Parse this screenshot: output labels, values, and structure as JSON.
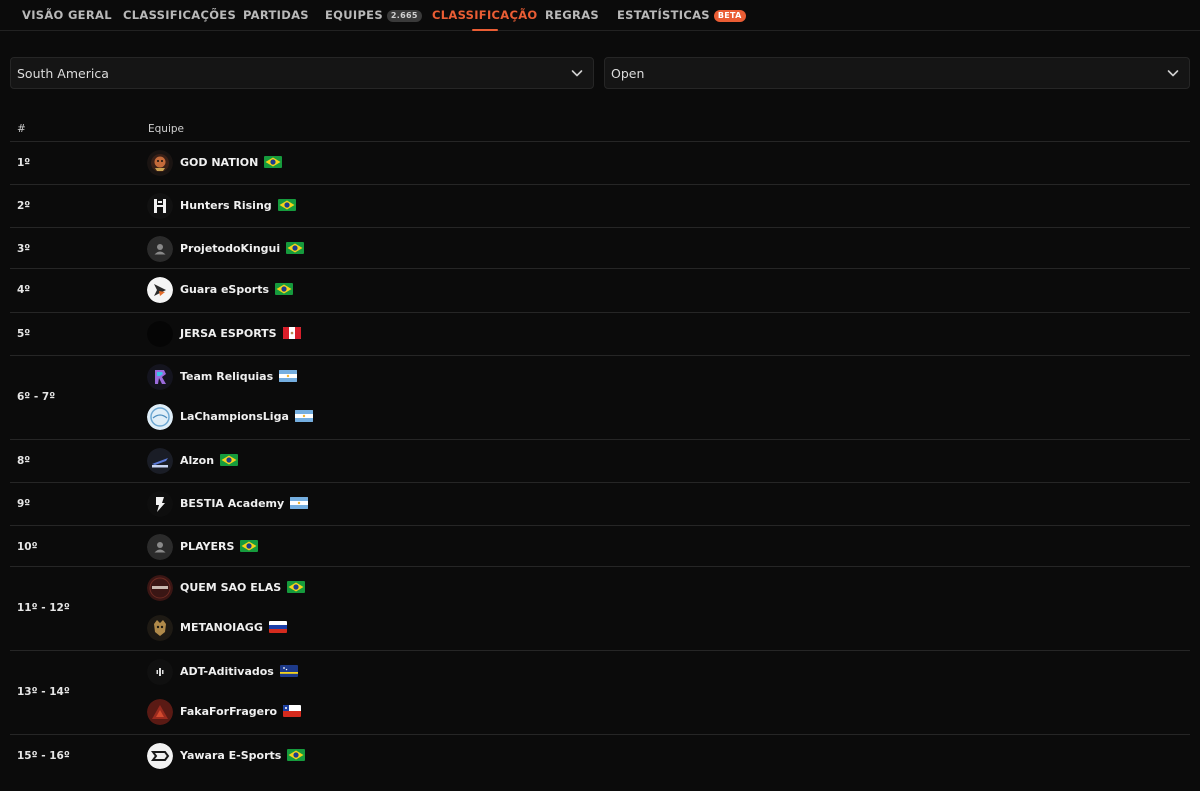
{
  "tabs": [
    {
      "label": "VISÃO GERAL"
    },
    {
      "label": "CLASSIFICAÇÕES"
    },
    {
      "label": "PARTIDAS"
    },
    {
      "label": "EQUIPES",
      "badge": "2.665"
    },
    {
      "label": "CLASSIFICAÇÃO",
      "active": true
    },
    {
      "label": "REGRAS"
    },
    {
      "label": "ESTATÍSTICAS",
      "badge": "BETA"
    }
  ],
  "filters": {
    "region": "South America",
    "division": "Open"
  },
  "table": {
    "col_rank": "#",
    "col_team": "Equipe",
    "groups": [
      {
        "rank": "1º",
        "teams": [
          {
            "name": "GOD NATION",
            "flag": "BR",
            "avatar": "godnation-logo"
          }
        ]
      },
      {
        "rank": "2º",
        "teams": [
          {
            "name": "Hunters Rising",
            "flag": "BR",
            "avatar": "hunters-logo"
          }
        ]
      },
      {
        "rank": "3º",
        "teams": [
          {
            "name": "ProjetodoKingui",
            "flag": "BR",
            "avatar": "default-avatar"
          }
        ]
      },
      {
        "rank": "4º",
        "teams": [
          {
            "name": "Guara eSports",
            "flag": "BR",
            "avatar": "guara-logo"
          }
        ]
      },
      {
        "rank": "5º",
        "teams": [
          {
            "name": "JERSA ESPORTS",
            "flag": "PE",
            "avatar": "jersa-logo"
          }
        ]
      },
      {
        "rank": "6º - 7º",
        "teams": [
          {
            "name": "Team Reliquias",
            "flag": "AR",
            "avatar": "reliquias-logo"
          },
          {
            "name": "LaChampionsLiga",
            "flag": "AR",
            "avatar": "lachampions-logo"
          }
        ]
      },
      {
        "rank": "8º",
        "teams": [
          {
            "name": "Alzon",
            "flag": "BR",
            "avatar": "alzon-logo"
          }
        ]
      },
      {
        "rank": "9º",
        "teams": [
          {
            "name": "BESTIA Academy",
            "flag": "AR",
            "avatar": "bestia-logo"
          }
        ]
      },
      {
        "rank": "10º",
        "teams": [
          {
            "name": "PLAYERS",
            "flag": "BR",
            "avatar": "default-avatar"
          }
        ]
      },
      {
        "rank": "11º - 12º",
        "teams": [
          {
            "name": "QUEM SAO ELAS",
            "flag": "BR",
            "avatar": "quemsaoelas-logo"
          },
          {
            "name": "METANOIAGG",
            "flag": "RU",
            "avatar": "metanoia-logo"
          }
        ]
      },
      {
        "rank": "13º - 14º",
        "teams": [
          {
            "name": "ADT-Aditivados",
            "flag": "CW",
            "avatar": "adt-logo"
          },
          {
            "name": "FakaForFragero",
            "flag": "CL",
            "avatar": "faka-logo"
          }
        ]
      },
      {
        "rank": "15º - 16º",
        "teams": [
          {
            "name": "Yawara E-Sports",
            "flag": "BR",
            "avatar": "yawara-logo"
          }
        ]
      }
    ]
  },
  "colors": {
    "accent": "#ea5d34",
    "background": "#0b0b0b",
    "divider": "#262626"
  }
}
